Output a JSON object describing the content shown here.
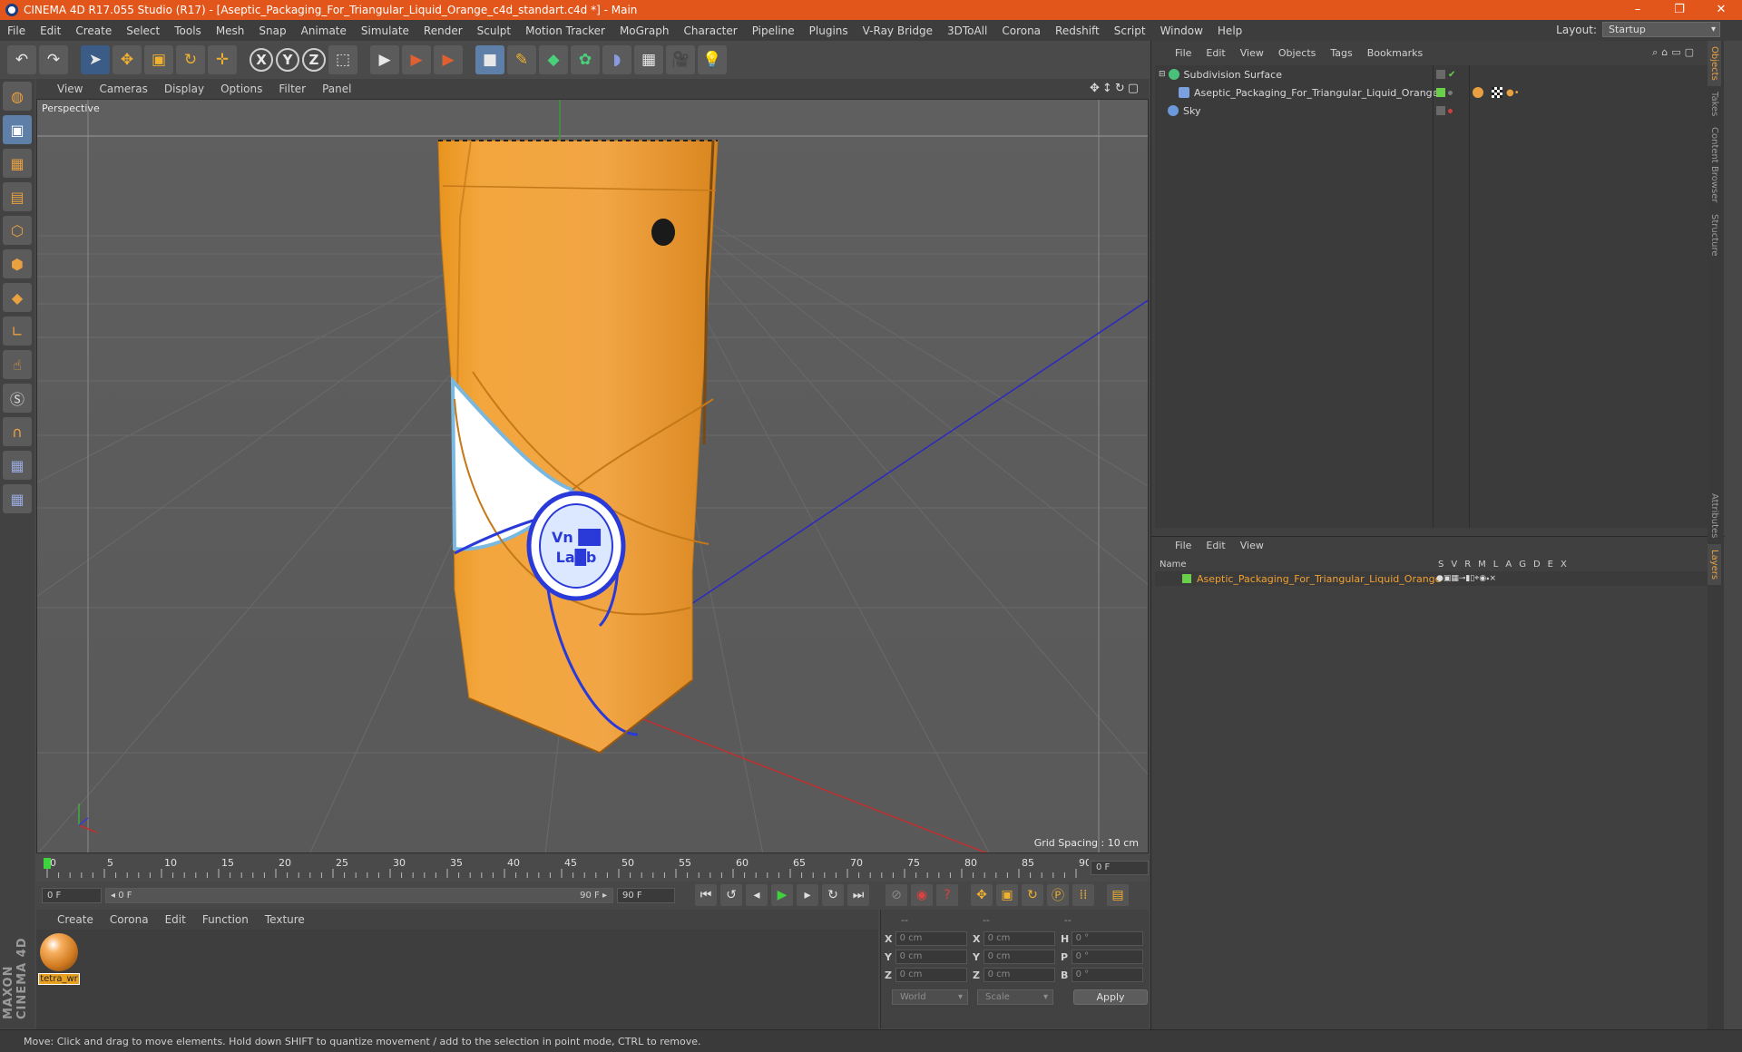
{
  "window": {
    "title": "CINEMA 4D R17.055 Studio (R17) - [Aseptic_Packaging_For_Triangular_Liquid_Orange_c4d_standart.c4d *] - Main",
    "minimize": "–",
    "maximize": "❐",
    "close": "✕"
  },
  "menu": [
    "File",
    "Edit",
    "Create",
    "Select",
    "Tools",
    "Mesh",
    "Snap",
    "Animate",
    "Simulate",
    "Render",
    "Sculpt",
    "Motion Tracker",
    "MoGraph",
    "Character",
    "Pipeline",
    "Plugins",
    "V-Ray Bridge",
    "3DToAll",
    "Corona",
    "Redshift",
    "Script",
    "Window",
    "Help"
  ],
  "layout": {
    "label": "Layout:",
    "value": "Startup"
  },
  "toolbar": {
    "undo": "↶",
    "redo": "↷",
    "select": "➤",
    "move": "✥",
    "scale": "▣",
    "rotate": "↻",
    "last": "✛",
    "x": "X",
    "y": "Y",
    "z": "Z",
    "coord": "⬚",
    "render1": "▶",
    "render2": "▶",
    "render3": "▶",
    "cube": "■",
    "pen": "✎",
    "subdiv": "◆",
    "array": "✿",
    "deform": "◗",
    "floor": "▦",
    "camera": "🎥",
    "light": "💡"
  },
  "viewport_menu": [
    "View",
    "Cameras",
    "Display",
    "Options",
    "Filter",
    "Panel"
  ],
  "viewport": {
    "label": "Perspective",
    "grid_spacing": "Grid Spacing : 10 cm",
    "nav": "✥↕↻▢",
    "label_text1": "Vn ██",
    "label_text2": "La█b"
  },
  "timeline": {
    "ticks": [
      "0",
      "5",
      "10",
      "15",
      "20",
      "25",
      "30",
      "35",
      "40",
      "45",
      "50",
      "55",
      "60",
      "65",
      "70",
      "75",
      "80",
      "85",
      "90"
    ],
    "frame": "0 F"
  },
  "playbar": {
    "start": "0 F",
    "range_start": "◂ 0 F",
    "range_end": "90 F ▸",
    "end": "90 F"
  },
  "material_menu": [
    "Create",
    "Corona",
    "Edit",
    "Function",
    "Texture"
  ],
  "material": {
    "name": "tetra_wr"
  },
  "coords": {
    "headers": [
      "--",
      "--",
      "--"
    ],
    "rows": [
      [
        "X",
        "0 cm",
        "X",
        "0 cm",
        "H",
        "0 °"
      ],
      [
        "Y",
        "0 cm",
        "Y",
        "0 cm",
        "P",
        "0 °"
      ],
      [
        "Z",
        "0 cm",
        "Z",
        "0 cm",
        "B",
        "0 °"
      ]
    ],
    "world": "World",
    "scale": "Scale",
    "apply": "Apply"
  },
  "status": "Move: Click and drag to move elements. Hold down SHIFT to quantize movement / add to the selection in point mode, CTRL to remove.",
  "objects_menu": [
    "File",
    "Edit",
    "View",
    "Objects",
    "Tags",
    "Bookmarks"
  ],
  "objects": [
    {
      "name": "Subdivision Surface",
      "color": "#4ac07a"
    },
    {
      "name": "Aseptic_Packaging_For_Triangular_Liquid_Orange",
      "color": "#7aa0e0"
    },
    {
      "name": "Sky",
      "color": "#6a9adb"
    }
  ],
  "layers_menu": [
    "File",
    "Edit",
    "View"
  ],
  "layers": {
    "header_name": "Name",
    "cols": [
      "S",
      "V",
      "R",
      "M",
      "L",
      "A",
      "G",
      "D",
      "E",
      "X"
    ],
    "row": "Aseptic_Packaging_For_Triangular_Liquid_Orange"
  },
  "sidetabs": [
    "Objects",
    "Takes",
    "Content Browser",
    "Structure"
  ],
  "sidetabs2": [
    "Attributes",
    "Layers"
  ],
  "maxon": "MAXON CINEMA 4D"
}
